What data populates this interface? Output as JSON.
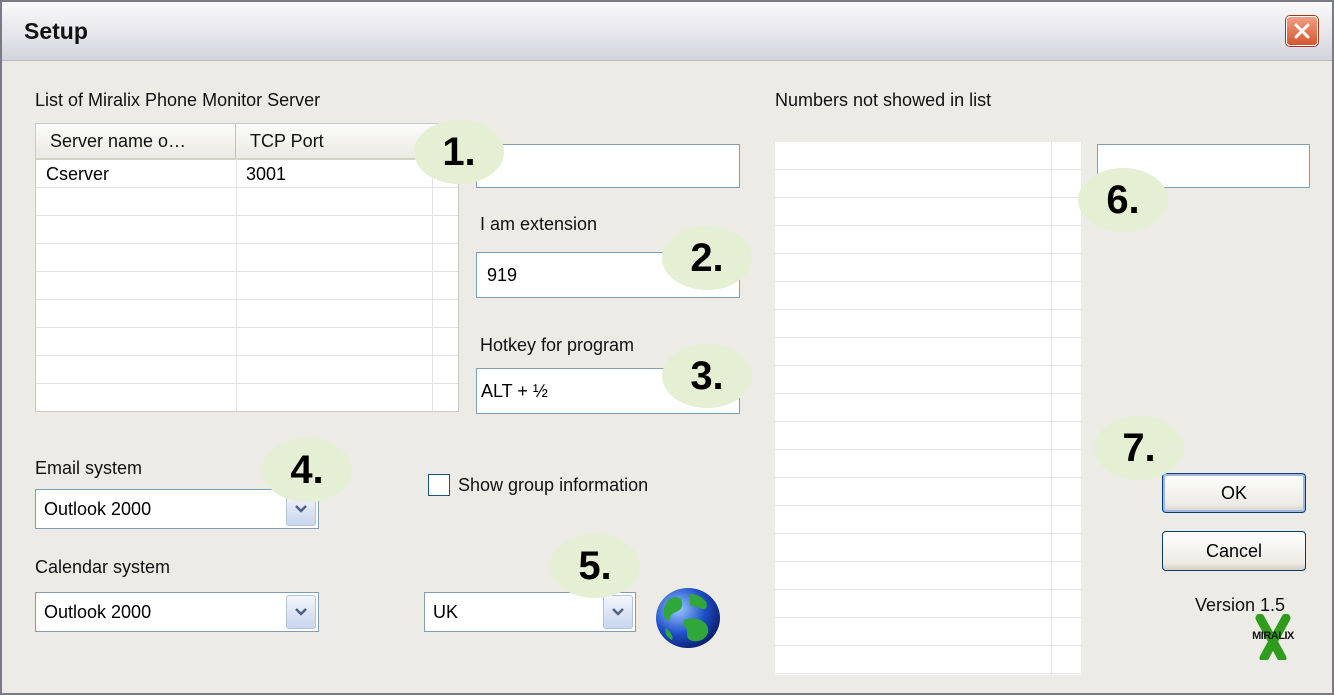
{
  "window": {
    "title": "Setup",
    "close_glyph": "✕"
  },
  "servers": {
    "label": "List of Miralix Phone Monitor Server",
    "columns": [
      "Server name o…",
      "TCP Port"
    ],
    "rows": [
      {
        "name": "Cserver",
        "port": "3001"
      }
    ],
    "server_input_value": ""
  },
  "extension": {
    "label": "I am extension",
    "value": "919"
  },
  "hotkey": {
    "label": "Hotkey for program",
    "value": "ALT + ½"
  },
  "email": {
    "label": "Email system",
    "value": "Outlook 2000"
  },
  "calendar": {
    "label": "Calendar system",
    "value": "Outlook 2000"
  },
  "group": {
    "label": "Show group information",
    "checked": false
  },
  "language": {
    "value": "UK"
  },
  "numbers": {
    "label": "Numbers not showed in list",
    "input_value": ""
  },
  "buttons": {
    "ok_label": "OK",
    "cancel_label": "Cancel"
  },
  "version": "Version 1.5",
  "logo_text": "MIRALIX",
  "callouts": [
    "1.",
    "2.",
    "3.",
    "4.",
    "5.",
    "6.",
    "7."
  ],
  "icons": {
    "close": "close-icon",
    "dropdown": "chevron-down-icon",
    "globe": "globe-icon"
  },
  "colors": {
    "callout_bg": "#e5efd4",
    "close_red": "#d5562f",
    "logo_green": "#2f9c1e"
  }
}
